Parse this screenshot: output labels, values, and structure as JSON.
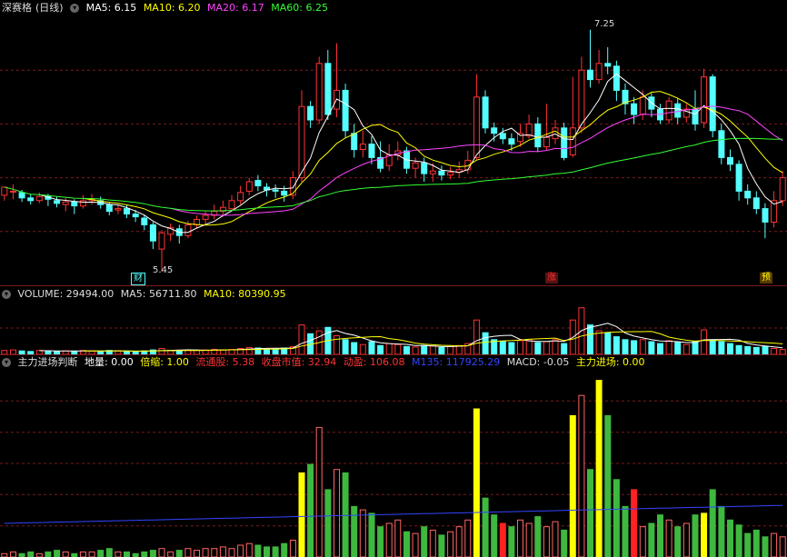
{
  "price_panel": {
    "stock_name": "深赛格",
    "period": "(日线)",
    "indicators": [
      {
        "label": "MA5: 6.15",
        "color": "#ffffff"
      },
      {
        "label": "MA10: 6.20",
        "color": "#ffff00"
      },
      {
        "label": "MA20: 6.17",
        "color": "#ff44ff"
      },
      {
        "label": "MA60: 6.25",
        "color": "#33ff33"
      }
    ],
    "high_label": "7.25",
    "low_label": "5.45",
    "markers": {
      "cai": "财",
      "zhang": "涨",
      "yu": "预"
    }
  },
  "volume_panel": {
    "indicators": [
      {
        "label": "VOLUME: 29494.00",
        "color": "#dddddd"
      },
      {
        "label": "MA5: 56711.80",
        "color": "#dddddd"
      },
      {
        "label": "MA10: 80390.95",
        "color": "#ffff00"
      }
    ]
  },
  "main_force_panel": {
    "indicators": [
      {
        "label": "主力进场判断",
        "color": "#dddddd"
      },
      {
        "label": "地量: 0.00",
        "color": "#ffffff"
      },
      {
        "label": "倍缩: 1.00",
        "color": "#ffff00"
      },
      {
        "label": "流通股: 5.38",
        "color": "#ff3333"
      },
      {
        "label": "收盘市值: 32.94",
        "color": "#ff3333"
      },
      {
        "label": "动盈: 106.08",
        "color": "#ff3333"
      },
      {
        "label": "M135: 117925.29",
        "color": "#3344ff"
      },
      {
        "label": "MACD: -0.05",
        "color": "#dddddd"
      },
      {
        "label": "主力进场: 0.00",
        "color": "#ffff00"
      }
    ]
  },
  "colors": {
    "up": "#ff3333",
    "down": "#54ffff",
    "grid": "#7a1a1a"
  },
  "chart_data": {
    "type": "candlestick",
    "candles": [
      [
        6.02,
        6.08,
        6.06,
        5.98
      ],
      [
        6.05,
        6.05,
        6.1,
        5.99
      ],
      [
        6.04,
        6.0,
        6.06,
        5.97
      ],
      [
        6.0,
        5.98,
        6.03,
        5.95
      ],
      [
        5.98,
        6.01,
        6.04,
        5.96
      ],
      [
        6.01,
        5.99,
        6.03,
        5.94
      ],
      [
        5.98,
        5.96,
        6.01,
        5.93
      ],
      [
        5.95,
        5.97,
        6.0,
        5.9
      ],
      [
        5.97,
        5.94,
        5.99,
        5.88
      ],
      [
        5.94,
        5.98,
        6.02,
        5.92
      ],
      [
        5.98,
        5.99,
        6.03,
        5.95
      ],
      [
        5.98,
        5.95,
        6.01,
        5.92
      ],
      [
        5.95,
        5.9,
        5.97,
        5.87
      ],
      [
        5.91,
        5.92,
        5.95,
        5.88
      ],
      [
        5.92,
        5.88,
        5.95,
        5.85
      ],
      [
        5.88,
        5.86,
        5.91,
        5.82
      ],
      [
        5.85,
        5.8,
        5.87,
        5.76
      ],
      [
        5.8,
        5.68,
        5.82,
        5.62
      ],
      [
        5.62,
        5.74,
        5.76,
        5.45
      ],
      [
        5.73,
        5.78,
        5.81,
        5.68
      ],
      [
        5.77,
        5.72,
        5.8,
        5.66
      ],
      [
        5.72,
        5.8,
        5.83,
        5.7
      ],
      [
        5.8,
        5.84,
        5.87,
        5.77
      ],
      [
        5.84,
        5.87,
        5.9,
        5.8
      ],
      [
        5.87,
        5.9,
        5.95,
        5.84
      ],
      [
        5.9,
        5.93,
        5.98,
        5.86
      ],
      [
        5.92,
        5.98,
        6.02,
        5.9
      ],
      [
        5.98,
        6.04,
        6.09,
        5.95
      ],
      [
        6.05,
        6.12,
        6.15,
        6.02
      ],
      [
        6.13,
        6.09,
        6.17,
        6.05
      ],
      [
        6.08,
        6.06,
        6.11,
        6.01
      ],
      [
        6.06,
        6.05,
        6.1,
        6.0
      ],
      [
        6.05,
        6.02,
        6.09,
        5.97
      ],
      [
        6.02,
        6.15,
        6.2,
        5.99
      ],
      [
        6.15,
        6.68,
        6.8,
        6.12
      ],
      [
        6.68,
        6.58,
        6.72,
        6.52
      ],
      [
        6.58,
        7.0,
        7.05,
        6.55
      ],
      [
        7.0,
        6.62,
        7.1,
        6.58
      ],
      [
        6.66,
        6.8,
        7.15,
        6.6
      ],
      [
        6.8,
        6.5,
        6.85,
        6.45
      ],
      [
        6.48,
        6.36,
        6.55,
        6.3
      ],
      [
        6.36,
        6.4,
        6.5,
        6.3
      ],
      [
        6.4,
        6.3,
        6.46,
        6.25
      ],
      [
        6.3,
        6.22,
        6.42,
        6.19
      ],
      [
        6.24,
        6.32,
        6.4,
        6.2
      ],
      [
        6.32,
        6.35,
        6.42,
        6.28
      ],
      [
        6.35,
        6.22,
        6.38,
        6.18
      ],
      [
        6.22,
        6.26,
        6.3,
        6.15
      ],
      [
        6.26,
        6.18,
        6.3,
        6.12
      ],
      [
        6.18,
        6.2,
        6.26,
        6.12
      ],
      [
        6.2,
        6.17,
        6.24,
        6.13
      ],
      [
        6.17,
        6.19,
        6.23,
        6.14
      ],
      [
        6.19,
        6.21,
        6.27,
        6.15
      ],
      [
        6.21,
        6.28,
        6.35,
        6.18
      ],
      [
        6.3,
        6.75,
        6.92,
        6.28
      ],
      [
        6.75,
        6.52,
        6.8,
        6.48
      ],
      [
        6.52,
        6.48,
        6.56,
        6.42
      ],
      [
        6.48,
        6.44,
        6.52,
        6.4
      ],
      [
        6.44,
        6.4,
        6.48,
        6.35
      ],
      [
        6.42,
        6.48,
        6.55,
        6.38
      ],
      [
        6.46,
        6.55,
        6.62,
        6.44
      ],
      [
        6.55,
        6.38,
        6.6,
        6.34
      ],
      [
        6.38,
        6.45,
        6.7,
        6.35
      ],
      [
        6.44,
        6.52,
        6.58,
        6.4
      ],
      [
        6.52,
        6.3,
        6.56,
        6.28
      ],
      [
        6.32,
        6.52,
        6.9,
        6.3
      ],
      [
        6.52,
        6.95,
        7.05,
        6.48
      ],
      [
        6.95,
        6.88,
        7.25,
        6.82
      ],
      [
        6.88,
        7.0,
        7.1,
        6.85
      ],
      [
        7.0,
        6.98,
        7.12,
        6.92
      ],
      [
        6.98,
        6.8,
        7.02,
        6.72
      ],
      [
        6.8,
        6.7,
        6.85,
        6.62
      ],
      [
        6.7,
        6.62,
        6.75,
        6.55
      ],
      [
        6.62,
        6.75,
        6.8,
        6.58
      ],
      [
        6.75,
        6.66,
        6.78,
        6.6
      ],
      [
        6.66,
        6.58,
        6.7,
        6.55
      ],
      [
        6.58,
        6.72,
        6.75,
        6.55
      ],
      [
        6.7,
        6.6,
        6.74,
        6.55
      ],
      [
        6.6,
        6.66,
        6.7,
        6.56
      ],
      [
        6.66,
        6.55,
        6.8,
        6.5
      ],
      [
        6.56,
        6.9,
        6.96,
        6.52
      ],
      [
        6.9,
        6.5,
        6.92,
        6.45
      ],
      [
        6.5,
        6.3,
        6.55,
        6.25
      ],
      [
        6.3,
        6.25,
        6.36,
        6.2
      ],
      [
        6.25,
        6.05,
        6.28,
        5.98
      ],
      [
        6.05,
        6.0,
        6.1,
        5.95
      ],
      [
        6.0,
        5.92,
        6.05,
        5.88
      ],
      [
        5.92,
        5.82,
        5.96,
        5.7
      ],
      [
        5.82,
        5.98,
        6.05,
        5.78
      ],
      [
        5.98,
        6.15,
        6.2,
        5.94
      ]
    ],
    "volume_values": [
      8,
      9,
      7,
      6,
      8,
      7,
      6,
      7,
      6,
      8,
      7,
      6,
      8,
      7,
      6,
      5,
      7,
      9,
      12,
      8,
      8,
      9,
      8,
      9,
      10,
      9,
      10,
      12,
      14,
      13,
      12,
      11,
      13,
      16,
      60,
      42,
      48,
      55,
      38,
      30,
      24,
      20,
      26,
      18,
      22,
      20,
      16,
      15,
      18,
      17,
      14,
      16,
      18,
      22,
      70,
      44,
      30,
      26,
      24,
      28,
      30,
      24,
      26,
      30,
      22,
      70,
      95,
      60,
      48,
      44,
      36,
      30,
      28,
      30,
      26,
      22,
      28,
      24,
      20,
      26,
      50,
      30,
      26,
      22,
      18,
      16,
      14,
      16,
      12,
      10
    ],
    "main_force_values": [
      2,
      3,
      2,
      3,
      2,
      3,
      4,
      3,
      2,
      3,
      3,
      4,
      5,
      3,
      3,
      2,
      3,
      4,
      5,
      3,
      4,
      5,
      4,
      5,
      5,
      6,
      5,
      7,
      8,
      7,
      6,
      6,
      8,
      10,
      50,
      55,
      77,
      40,
      52,
      50,
      30,
      28,
      26,
      18,
      20,
      22,
      15,
      14,
      18,
      16,
      13,
      15,
      18,
      22,
      88,
      35,
      25,
      20,
      18,
      22,
      20,
      24,
      18,
      21,
      16,
      84,
      96,
      52,
      105,
      84,
      46,
      30,
      40,
      18,
      20,
      25,
      22,
      18,
      20,
      25,
      26,
      40,
      30,
      22,
      19,
      14,
      16,
      12,
      14,
      12
    ]
  }
}
